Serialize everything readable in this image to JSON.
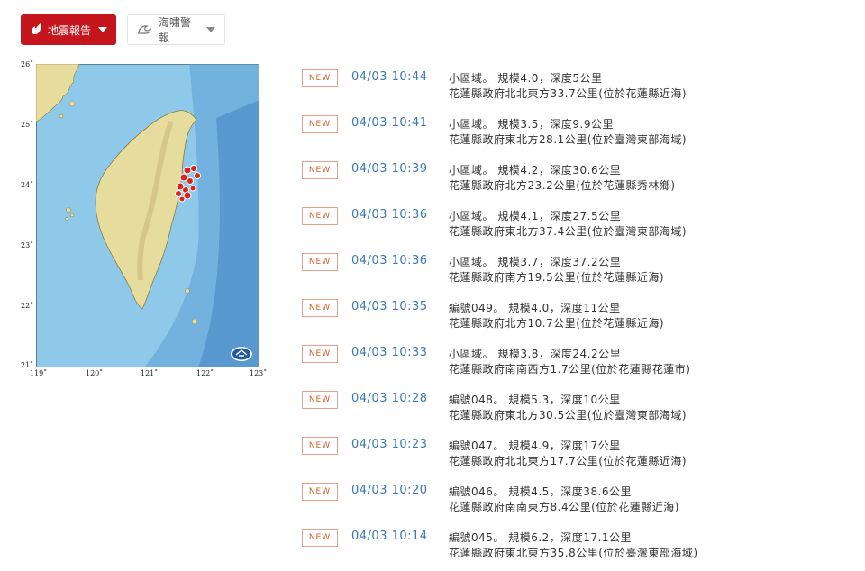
{
  "tabs": {
    "earthquake": "地震報告",
    "tsunami": "海嘯警報"
  },
  "map": {
    "lat_labels": [
      "26˚",
      "25˚",
      "24˚",
      "23˚",
      "22˚",
      "21˚"
    ],
    "lon_labels": [
      "119˚",
      "120˚",
      "121˚",
      "122˚",
      "123˚"
    ],
    "colors": {
      "sea": "#8ec9ea",
      "land": "#e6dc9e",
      "marker": "#d9231d"
    }
  },
  "reports": [
    {
      "badge": "NEW",
      "time": "04/03 10:44",
      "line1": "小區域。 規模4.0，深度5公里",
      "line2": "花蓮縣政府北北東方33.7公里(位於花蓮縣近海)"
    },
    {
      "badge": "NEW",
      "time": "04/03 10:41",
      "line1": "小區域。 規模3.5，深度9.9公里",
      "line2": "花蓮縣政府東北方28.1公里(位於臺灣東部海域)"
    },
    {
      "badge": "NEW",
      "time": "04/03 10:39",
      "line1": "小區域。 規模4.2，深度30.6公里",
      "line2": "花蓮縣政府北方23.2公里(位於花蓮縣秀林鄉)"
    },
    {
      "badge": "NEW",
      "time": "04/03 10:36",
      "line1": "小區域。 規模4.1，深度27.5公里",
      "line2": "花蓮縣政府東北方37.4公里(位於臺灣東部海域)"
    },
    {
      "badge": "NEW",
      "time": "04/03 10:36",
      "line1": "小區域。 規模3.7，深度37.2公里",
      "line2": "花蓮縣政府南方19.5公里(位於花蓮縣近海)"
    },
    {
      "badge": "NEW",
      "time": "04/03 10:35",
      "line1": "編號049。 規模4.0，深度11公里",
      "line2": "花蓮縣政府北方10.7公里(位於花蓮縣近海)"
    },
    {
      "badge": "NEW",
      "time": "04/03 10:33",
      "line1": "小區域。 規模3.8，深度24.2公里",
      "line2": "花蓮縣政府南南西方1.7公里(位於花蓮縣花蓮市)"
    },
    {
      "badge": "NEW",
      "time": "04/03 10:28",
      "line1": "編號048。 規模5.3，深度10公里",
      "line2": "花蓮縣政府東北方30.5公里(位於臺灣東部海域)"
    },
    {
      "badge": "NEW",
      "time": "04/03 10:23",
      "line1": "編號047。 規模4.9，深度17公里",
      "line2": "花蓮縣政府北北東方17.7公里(位於花蓮縣近海)"
    },
    {
      "badge": "NEW",
      "time": "04/03 10:20",
      "line1": "編號046。 規模4.5，深度38.6公里",
      "line2": "花蓮縣政府南南東方8.4公里(位於花蓮縣近海)"
    },
    {
      "badge": "NEW",
      "time": "04/03 10:14",
      "line1": "編號045。 規模6.2，深度17.1公里",
      "line2": "花蓮縣政府東北東方35.8公里(位於臺灣東部海域)"
    }
  ]
}
